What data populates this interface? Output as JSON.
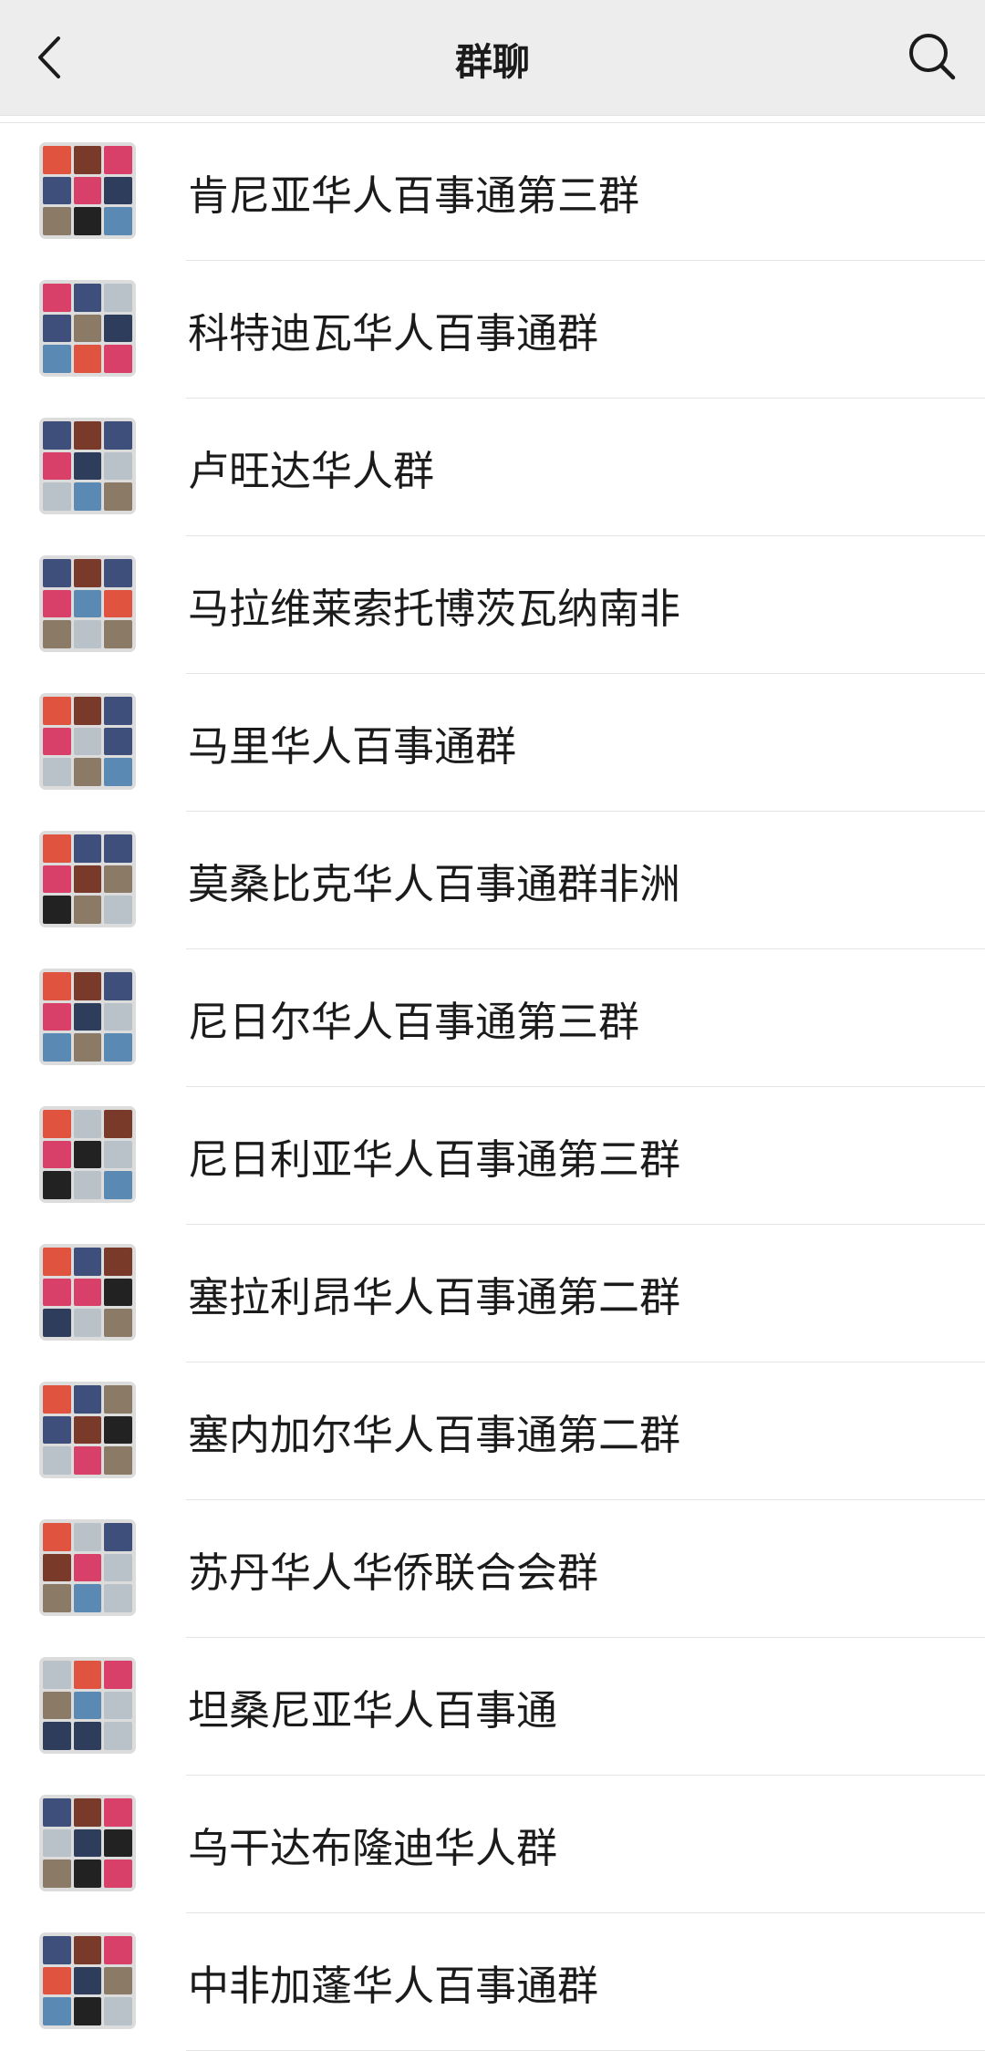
{
  "header": {
    "title": "群聊",
    "back_icon": "chevron-left-icon",
    "search_icon": "search-icon"
  },
  "groups": [
    {
      "name": "肯尼亚华人百事通第三群"
    },
    {
      "name": "科特迪瓦华人百事通群"
    },
    {
      "name": "卢旺达华人群"
    },
    {
      "name": "马拉维莱索托博茨瓦纳南非"
    },
    {
      "name": "马里华人百事通群"
    },
    {
      "name": "莫桑比克华人百事通群非洲"
    },
    {
      "name": "尼日尔华人百事通第三群"
    },
    {
      "name": "尼日利亚华人百事通第三群"
    },
    {
      "name": "塞拉利昂华人百事通第二群"
    },
    {
      "name": "塞内加尔华人百事通第二群"
    },
    {
      "name": "苏丹华人华侨联合会群"
    },
    {
      "name": "坦桑尼亚华人百事通"
    },
    {
      "name": "乌干达布隆迪华人群"
    },
    {
      "name": "中非加蓬华人百事通群"
    }
  ]
}
